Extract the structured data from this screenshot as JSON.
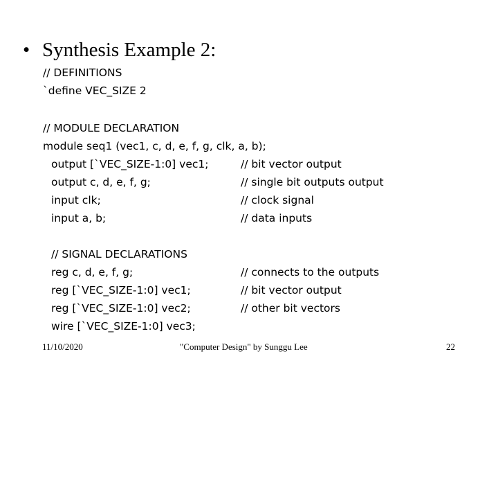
{
  "slide": {
    "bullet": "•",
    "title": "Synthesis Example 2:",
    "definitions_comment": "// DEFINITIONS",
    "define_line": "`define VEC_SIZE 2",
    "module_comment": "// MODULE DECLARATION",
    "module_line": "module seq1 (vec1, c, d, e, f, g, clk, a, b);",
    "ports": [
      {
        "code": "output [`VEC_SIZE-1:0] vec1;",
        "comment": "// bit vector output"
      },
      {
        "code": "output c, d, e, f, g;",
        "comment": "// single bit outputs output"
      },
      {
        "code": "input clk;",
        "comment": "// clock signal"
      },
      {
        "code": "input a, b;",
        "comment": "// data inputs"
      }
    ],
    "signal_comment": "// SIGNAL DECLARATIONS",
    "signals": [
      {
        "code": "reg c, d, e, f, g;",
        "comment": "// connects to the outputs"
      },
      {
        "code": "reg [`VEC_SIZE-1:0] vec1;",
        "comment": "// bit vector output"
      },
      {
        "code": "reg [`VEC_SIZE-1:0] vec2;",
        "comment": "// other bit vectors"
      },
      {
        "code": "wire [`VEC_SIZE-1:0] vec3;",
        "comment": ""
      }
    ]
  },
  "footer": {
    "date": "11/10/2020",
    "course": "\"Computer Design\" by Sunggu Lee",
    "page": "22"
  }
}
